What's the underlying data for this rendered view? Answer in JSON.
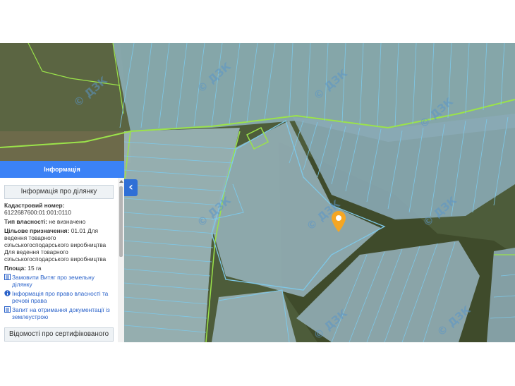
{
  "panel": {
    "header_title": "Інформація",
    "section_title": "Інформація про ділянку",
    "cadastral_label": "Кадастровий номер:",
    "cadastral_value": "6122687600:01:001:0110",
    "ownership_label": "Тип власності:",
    "ownership_value": "не визначено",
    "purpose_label": "Цільове призначення:",
    "purpose_value": "01.01 Для ведення товарного сільськогосподарського виробництва Для ведення товарного сільськогосподарського виробництва",
    "area_label": "Площа:",
    "area_value": "15 га",
    "links": [
      {
        "label": "Замовити Витяг про земельну ділянку",
        "icon": "document-icon"
      },
      {
        "label": "Інформація про право власності та речові права",
        "icon": "info-icon"
      },
      {
        "label": "Запит на отримання документації із землеустрою",
        "icon": "document-icon"
      }
    ],
    "bottom_section_title": "Відомості про сертифікованого"
  },
  "map": {
    "watermark_text": "© ДЗК",
    "marker_color": "#f5a623",
    "parcel_outline_color": "#7ec8e8",
    "boundary_color": "#9be34a"
  },
  "colors": {
    "header_bg": "#3b82f6",
    "link": "#2a62c9",
    "collapse_button": "#2f6fd6"
  }
}
